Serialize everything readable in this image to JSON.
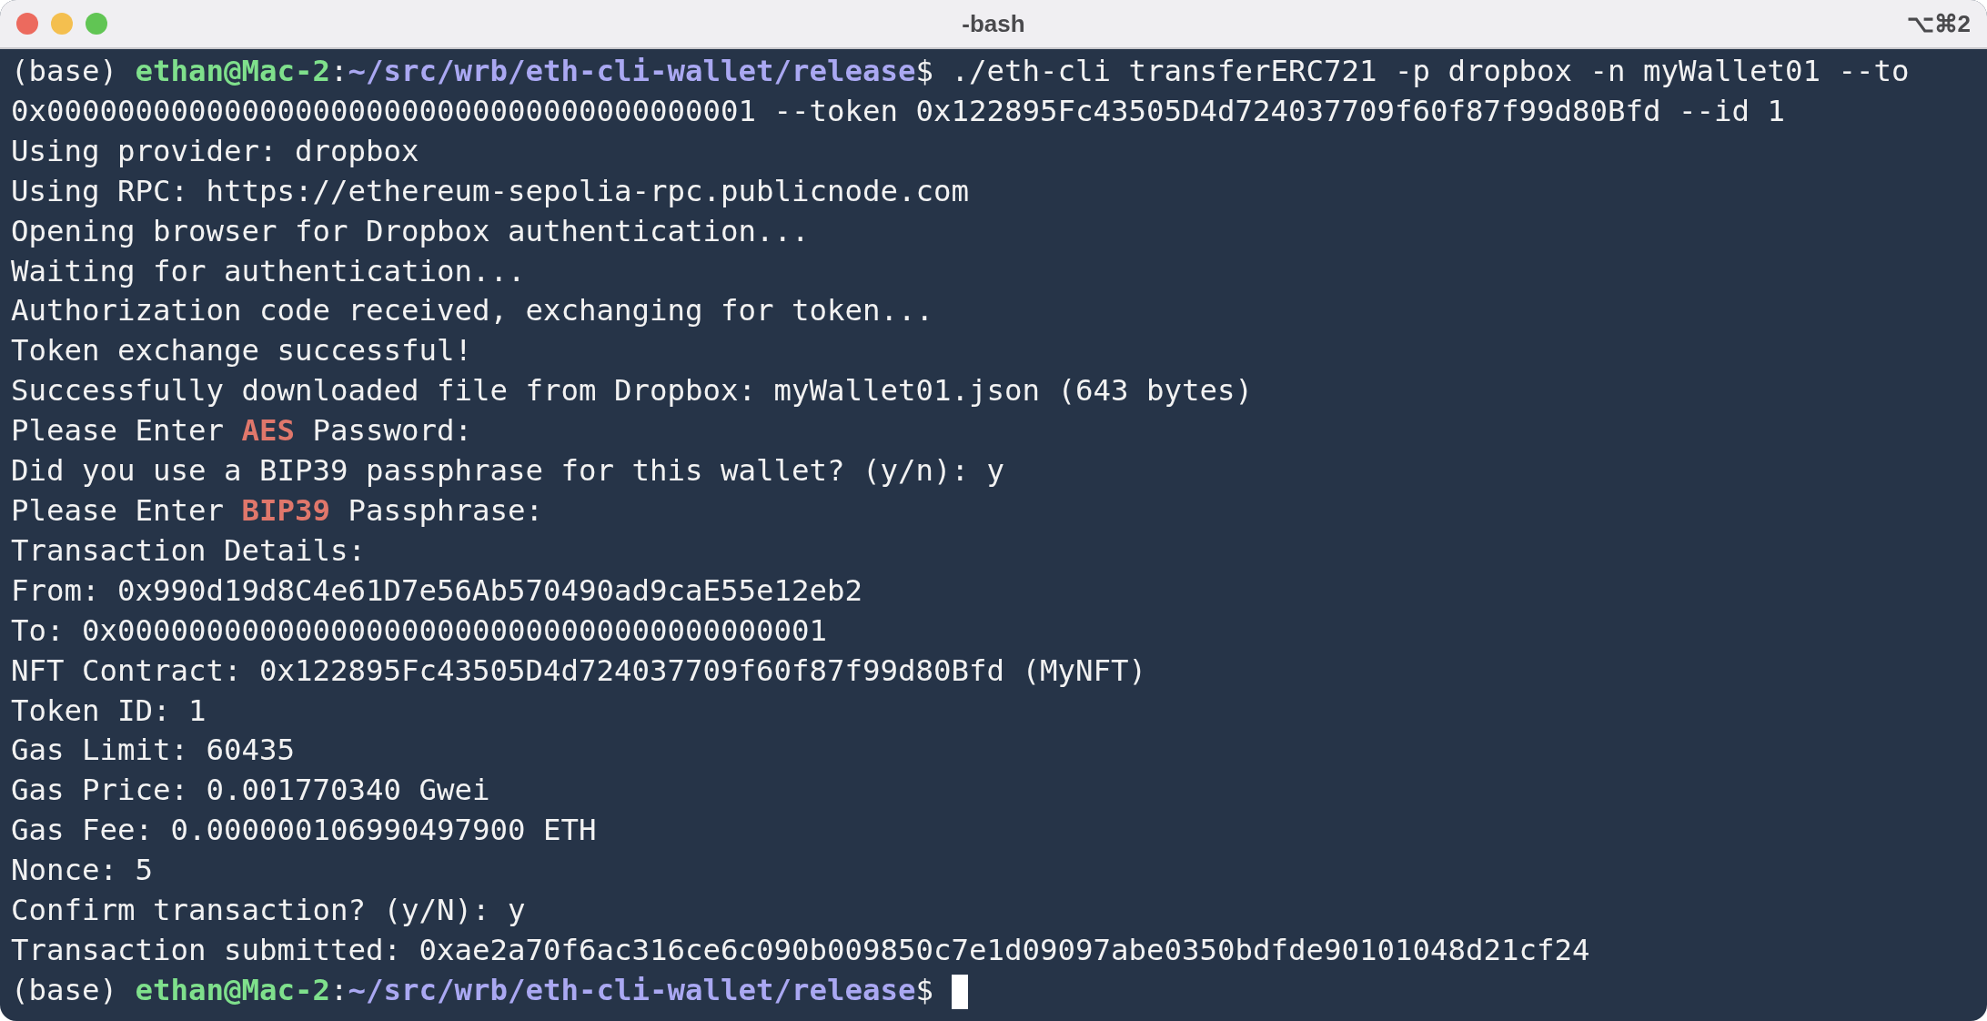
{
  "window": {
    "title": "-bash",
    "shortcut": "⌥⌘2"
  },
  "terminal": {
    "lines": [
      [
        {
          "kind": "plain",
          "text": "(base) "
        },
        {
          "kind": "user",
          "text": "ethan@Mac-2"
        },
        {
          "kind": "plain",
          "text": ":"
        },
        {
          "kind": "path",
          "text": "~/src/wrb/eth-cli-wallet/release"
        },
        {
          "kind": "plain",
          "text": "$ ./eth-cli transferERC721 -p dropbox -n myWallet01 --to"
        }
      ],
      [
        {
          "kind": "plain",
          "text": "0x0000000000000000000000000000000000000001 --token 0x122895Fc43505D4d724037709f60f87f99d80Bfd --id 1"
        }
      ],
      [
        {
          "kind": "plain",
          "text": "Using provider: dropbox"
        }
      ],
      [
        {
          "kind": "plain",
          "text": "Using RPC: https://ethereum-sepolia-rpc.publicnode.com"
        }
      ],
      [
        {
          "kind": "plain",
          "text": "Opening browser for Dropbox authentication..."
        }
      ],
      [
        {
          "kind": "plain",
          "text": "Waiting for authentication..."
        }
      ],
      [
        {
          "kind": "plain",
          "text": "Authorization code received, exchanging for token..."
        }
      ],
      [
        {
          "kind": "plain",
          "text": "Token exchange successful!"
        }
      ],
      [
        {
          "kind": "plain",
          "text": "Successfully downloaded file from Dropbox: myWallet01.json (643 bytes)"
        }
      ],
      [
        {
          "kind": "plain",
          "text": "Please Enter "
        },
        {
          "kind": "highlight",
          "text": "AES"
        },
        {
          "kind": "plain",
          "text": " Password:"
        }
      ],
      [
        {
          "kind": "plain",
          "text": "Did you use a BIP39 passphrase for this wallet? (y/n): y"
        }
      ],
      [
        {
          "kind": "plain",
          "text": "Please Enter "
        },
        {
          "kind": "highlight",
          "text": "BIP39"
        },
        {
          "kind": "plain",
          "text": " Passphrase:"
        }
      ],
      [
        {
          "kind": "plain",
          "text": "Transaction Details:"
        }
      ],
      [
        {
          "kind": "plain",
          "text": "From: 0x990d19d8C4e61D7e56Ab570490ad9caE55e12eb2"
        }
      ],
      [
        {
          "kind": "plain",
          "text": "To: 0x0000000000000000000000000000000000000001"
        }
      ],
      [
        {
          "kind": "plain",
          "text": "NFT Contract: 0x122895Fc43505D4d724037709f60f87f99d80Bfd (MyNFT)"
        }
      ],
      [
        {
          "kind": "plain",
          "text": "Token ID: 1"
        }
      ],
      [
        {
          "kind": "plain",
          "text": "Gas Limit: 60435"
        }
      ],
      [
        {
          "kind": "plain",
          "text": "Gas Price: 0.001770340 Gwei"
        }
      ],
      [
        {
          "kind": "plain",
          "text": "Gas Fee: 0.000000106990497900 ETH"
        }
      ],
      [
        {
          "kind": "plain",
          "text": "Nonce: 5"
        }
      ],
      [
        {
          "kind": "plain",
          "text": "Confirm transaction? (y/N): y"
        }
      ],
      [
        {
          "kind": "plain",
          "text": "Transaction submitted: 0xae2a70f6ac316ce6c090b009850c7e1d09097abe0350bdfde90101048d21cf24"
        }
      ],
      [
        {
          "kind": "plain",
          "text": "(base) "
        },
        {
          "kind": "user",
          "text": "ethan@Mac-2"
        },
        {
          "kind": "plain",
          "text": ":"
        },
        {
          "kind": "path",
          "text": "~/src/wrb/eth-cli-wallet/release"
        },
        {
          "kind": "plain",
          "text": "$ "
        },
        {
          "kind": "cursor"
        }
      ]
    ]
  }
}
